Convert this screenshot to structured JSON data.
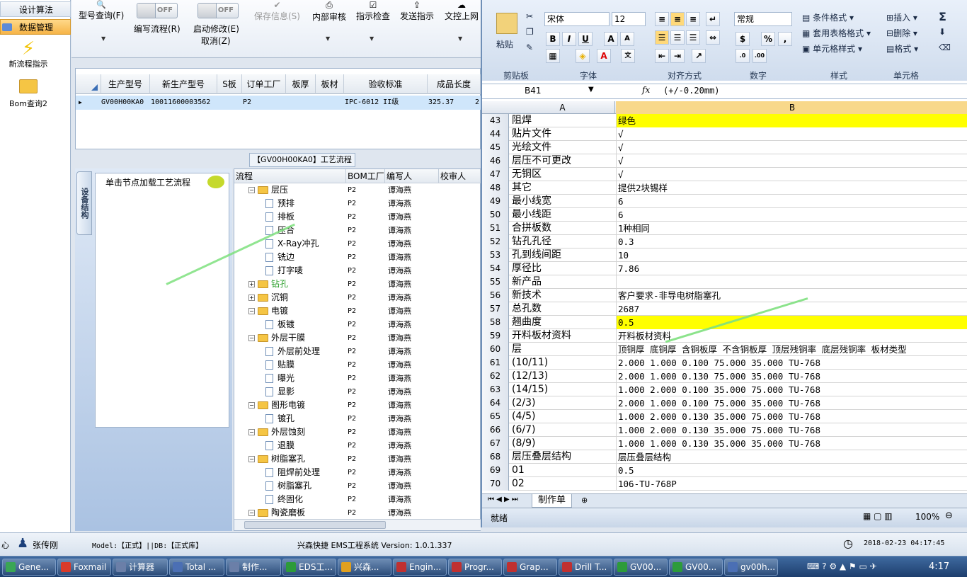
{
  "left_nav": {
    "design_algo": "设计算法",
    "data_mgmt": "数据管理",
    "new_flow": "新流程指示",
    "bom_query": "Bom查询2"
  },
  "toolbar": {
    "model_query": "型号查询(F)",
    "toggle_off": "OFF",
    "write_flow": "编写流程(R)",
    "start_modify": "启动修改(E)",
    "cancel": "取消(Z)",
    "save": "保存信息(S)",
    "internal_review": "内部审核",
    "check": "指示检查",
    "send": "发送指示",
    "print": "文控上网"
  },
  "grid": {
    "headers": [
      "生产型号",
      "新生产型号",
      "S板",
      "订单工厂",
      "板厚",
      "板材",
      "验收标准",
      "成品长度"
    ],
    "row": [
      "GV00H00KA0",
      "10011600003562",
      "",
      "P2",
      "",
      "",
      "IPC-6012 II级",
      "325.37"
    ],
    "row_extra": "2"
  },
  "process": {
    "title": "【GV00H00KA0】工艺流程",
    "side_tab": "设备结构",
    "click_hint": "单击节点加载工艺流程",
    "headers": [
      "流程",
      "BOM工厂",
      "编写人",
      "校审人"
    ],
    "rows": [
      {
        "name": "层压",
        "level": 0,
        "type": "folder",
        "bom": "P2",
        "writer": "谭海燕"
      },
      {
        "name": "预排",
        "level": 1,
        "type": "doc",
        "bom": "P2",
        "writer": "谭海燕"
      },
      {
        "name": "排板",
        "level": 1,
        "type": "doc",
        "bom": "P2",
        "writer": "谭海燕"
      },
      {
        "name": "压合",
        "level": 1,
        "type": "doc",
        "bom": "P2",
        "writer": "谭海燕"
      },
      {
        "name": "X-Ray冲孔",
        "level": 1,
        "type": "doc",
        "bom": "P2",
        "writer": "谭海燕"
      },
      {
        "name": "铣边",
        "level": 1,
        "type": "doc",
        "bom": "P2",
        "writer": "谭海燕"
      },
      {
        "name": "打字唛",
        "level": 1,
        "type": "doc",
        "bom": "P2",
        "writer": "谭海燕"
      },
      {
        "name": "钻孔",
        "level": 0,
        "type": "folder",
        "bom": "P2",
        "writer": "谭海燕",
        "collapsed": true,
        "highlight": true
      },
      {
        "name": "沉铜",
        "level": 0,
        "type": "folder",
        "bom": "P2",
        "writer": "谭海燕",
        "collapsed": true
      },
      {
        "name": "电镀",
        "level": 0,
        "type": "folder",
        "bom": "P2",
        "writer": "谭海燕"
      },
      {
        "name": "板镀",
        "level": 1,
        "type": "doc",
        "bom": "P2",
        "writer": "谭海燕"
      },
      {
        "name": "外层干膜",
        "level": 0,
        "type": "folder",
        "bom": "P2",
        "writer": "谭海燕"
      },
      {
        "name": "外层前处理",
        "level": 1,
        "type": "doc",
        "bom": "P2",
        "writer": "谭海燕"
      },
      {
        "name": "贴膜",
        "level": 1,
        "type": "doc",
        "bom": "P2",
        "writer": "谭海燕"
      },
      {
        "name": "曝光",
        "level": 1,
        "type": "doc",
        "bom": "P2",
        "writer": "谭海燕"
      },
      {
        "name": "显影",
        "level": 1,
        "type": "doc",
        "bom": "P2",
        "writer": "谭海燕"
      },
      {
        "name": "图形电镀",
        "level": 0,
        "type": "folder",
        "bom": "P2",
        "writer": "谭海燕"
      },
      {
        "name": "镀孔",
        "level": 1,
        "type": "doc",
        "bom": "P2",
        "writer": "谭海燕"
      },
      {
        "name": "外层蚀刻",
        "level": 0,
        "type": "folder",
        "bom": "P2",
        "writer": "谭海燕"
      },
      {
        "name": "退膜",
        "level": 1,
        "type": "doc",
        "bom": "P2",
        "writer": "谭海燕"
      },
      {
        "name": "树脂塞孔",
        "level": 0,
        "type": "folder",
        "bom": "P2",
        "writer": "谭海燕"
      },
      {
        "name": "阻焊前处理",
        "level": 1,
        "type": "doc",
        "bom": "P2",
        "writer": "谭海燕"
      },
      {
        "name": "树脂塞孔",
        "level": 1,
        "type": "doc",
        "bom": "P2",
        "writer": "谭海燕"
      },
      {
        "name": "终固化",
        "level": 1,
        "type": "doc",
        "bom": "P2",
        "writer": "谭海燕"
      },
      {
        "name": "陶瓷磨板",
        "level": 0,
        "type": "folder",
        "bom": "P2",
        "writer": "谭海燕"
      }
    ]
  },
  "excel": {
    "ribbon": {
      "paste": "粘贴",
      "font": "宋体",
      "size": "12",
      "number_format": "常规",
      "cond_format": "条件格式",
      "table_format": "套用表格格式",
      "cell_style": "单元格样式",
      "insert": "插入",
      "delete": "删除",
      "format": "格式",
      "groups": [
        "剪贴板",
        "字体",
        "对齐方式",
        "数字",
        "样式",
        "单元格"
      ]
    },
    "name_box": "B41",
    "formula": "(+/-0.20mm)",
    "col_a": "A",
    "col_b": "B",
    "rows": [
      {
        "n": "43",
        "a": "阻焊",
        "b": "绿色",
        "yellow": true
      },
      {
        "n": "44",
        "a": "贴片文件",
        "b": "√"
      },
      {
        "n": "45",
        "a": "光绘文件",
        "b": "√"
      },
      {
        "n": "46",
        "a": "层压不可更改",
        "b": "√"
      },
      {
        "n": "47",
        "a": "无铜区",
        "b": "√"
      },
      {
        "n": "48",
        "a": "其它",
        "b": "提供2块锡样"
      },
      {
        "n": "49",
        "a": "最小线宽",
        "b": "6"
      },
      {
        "n": "50",
        "a": "最小线距",
        "b": "6"
      },
      {
        "n": "51",
        "a": "合拼板数",
        "b": "1种相同"
      },
      {
        "n": "52",
        "a": "钻孔孔径",
        "b": "0.3"
      },
      {
        "n": "53",
        "a": "孔到线间距",
        "b": "10"
      },
      {
        "n": "54",
        "a": "厚径比",
        "b": "7.86"
      },
      {
        "n": "55",
        "a": "新产品",
        "b": ""
      },
      {
        "n": "56",
        "a": "新技术",
        "b": "客户要求-非导电树脂塞孔"
      },
      {
        "n": "57",
        "a": "总孔数",
        "b": "2687"
      },
      {
        "n": "58",
        "a": "翘曲度",
        "b": "0.5",
        "yellow": true
      },
      {
        "n": "59",
        "a": "开料板材资料",
        "b": "开料板材资料"
      },
      {
        "n": "60",
        "a": "层",
        "b": "顶铜厚 底铜厚  含铜板厚  不含铜板厚  顶层残铜率  底层残铜率  板材类型"
      },
      {
        "n": "61",
        "a": "(10/11)",
        "b": "2.000  1.000         0.100       75.000     35.000     TU-768"
      },
      {
        "n": "62",
        "a": "(12/13)",
        "b": "2.000  1.000         0.130       75.000     35.000     TU-768"
      },
      {
        "n": "63",
        "a": "(14/15)",
        "b": "1.000  2.000         0.100       35.000     75.000     TU-768"
      },
      {
        "n": "64",
        "a": "(2/3)",
        "b": "2.000  1.000         0.100       75.000     35.000     TU-768"
      },
      {
        "n": "65",
        "a": "(4/5)",
        "b": "1.000  2.000         0.130       35.000     75.000     TU-768"
      },
      {
        "n": "66",
        "a": "(6/7)",
        "b": "1.000  2.000         0.130       35.000     75.000     TU-768"
      },
      {
        "n": "67",
        "a": "(8/9)",
        "b": "1.000  1.000         0.130       35.000     35.000     TU-768"
      },
      {
        "n": "68",
        "a": "层压叠层结构",
        "b": "层压叠层结构"
      },
      {
        "n": "69",
        "a": "01",
        "b": "0.5"
      },
      {
        "n": "70",
        "a": "02",
        "b": "106-TU-768P"
      }
    ],
    "sheet_tab": "制作单",
    "status": "就绪",
    "zoom": "100%"
  },
  "status_bar": {
    "left": "心",
    "user": "张传刚",
    "model_db": "Model:【正式】||DB:【正式库】",
    "system": "兴森快捷 EMS工程系统 Version: 1.0.1.337",
    "datetime": "2018-02-23 04:17:45"
  },
  "taskbar": {
    "items": [
      "Gene...",
      "Foxmail",
      "计算器",
      "Total ...",
      "制作...",
      "EDS工...",
      "兴森...",
      "Engin...",
      "Progr...",
      "Grap...",
      "Drill T...",
      "GV00...",
      "GV00...",
      "gv00h..."
    ],
    "time": "4:17"
  }
}
